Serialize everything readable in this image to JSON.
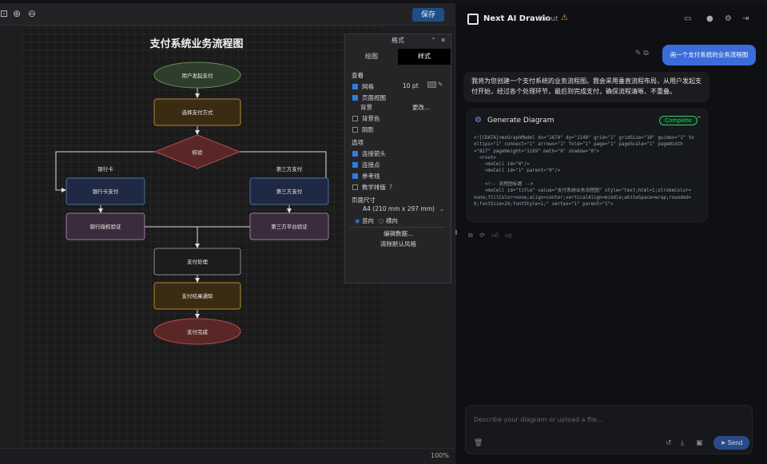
{
  "editor": {
    "save_label": "保存",
    "zoom": "100%",
    "diagram": {
      "title": "支付系统业务流程图",
      "nodes": {
        "start": "用户发起支付",
        "choose": "选择支付方式",
        "check": "校验",
        "bank_card": "银行卡支付",
        "third_party": "第三方支付",
        "bank_auth": "银行授权验证",
        "third_auth": "第三方平台验证",
        "process": "支付处理",
        "notify": "支付结果通知",
        "done": "支付完成"
      },
      "edge_labels": {
        "left": "银行卡",
        "right": "第三方支付"
      }
    },
    "format_panel": {
      "title": "格式",
      "tabs": [
        "绘图",
        "样式"
      ],
      "view_section": "查看",
      "grid": "网格",
      "grid_size": "10 pt",
      "page_view": "页面视图",
      "background": "背景",
      "change": "更改...",
      "bg_color": "背景色",
      "shadow": "阴影",
      "options_section": "选项",
      "connection_arrows": "连接箭头",
      "connection_points": "连接点",
      "guides": "参考线",
      "math": "数学排版",
      "page_size_section": "页面尺寸",
      "paper": "A4 (210 mm x 297 mm)",
      "portrait": "竖向",
      "landscape": "横向",
      "edit_data": "编辑数据...",
      "clear_style": "清除默认风格"
    }
  },
  "chat": {
    "app_title": "Next AI Drawio",
    "about": "About",
    "user_message": "画一个支付系统的业务流程图",
    "assistant_message": "我将为您创建一个支付系统的业务流程图。我会采用垂直流程布局，从用户发起支付开始，经过各个处理环节，最后到完成支付，确保流程清晰、不重叠。",
    "tool_title": "Generate Diagram",
    "tool_status": "Complete",
    "code_lines": [
      "<![CDATA[<mxGraphModel dx=\"1674\" dy=\"1148\" grid=\"1\" gridSize=\"10\" guides=\"1\" to",
      "oltips=\"1\" connect=\"1\" arrows=\"1\" fold=\"1\" page=\"1\" pageScale=\"1\" pageWidth",
      "=\"827\" pageHeight=\"1169\" math=\"0\" shadow=\"0\">",
      "  <root>",
      "    <mxCell id=\"0\"/>",
      "    <mxCell id=\"1\" parent=\"0\"/>",
      "",
      "    <!-- 流程图标题 -->",
      "    <mxCell id=\"title\" value=\"支付系统业务流程图\" style=\"text;html=1;strokeColor=",
      "none;fillColor=none;align=center;verticalAlign=middle;whiteSpace=wrap;rounded=",
      "0;fontSize=24;fontStyle=1;\" vertex=\"1\" parent=\"1\">"
    ],
    "composer_placeholder": "Describe your diagram or upload a file...",
    "send_label": "Send"
  }
}
